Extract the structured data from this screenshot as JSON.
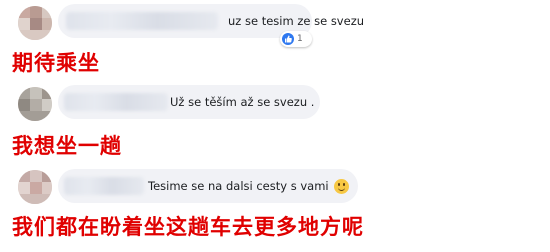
{
  "comments": [
    {
      "text": "uz se tesim ze se svezu",
      "reaction_count": "1"
    },
    {
      "text": "Už se těším až se svezu ."
    },
    {
      "text": "Tesime se na dalsi cesty s vami",
      "emoji": "smiling-face-emoji"
    }
  ],
  "captions": [
    "期待乘坐",
    "我想坐一趟",
    "我们都在盼着坐这趟车去更多地方呢"
  ],
  "colors": {
    "caption": "#e00000",
    "bubble": "#f1f2f6",
    "like": "#2e78f0"
  }
}
